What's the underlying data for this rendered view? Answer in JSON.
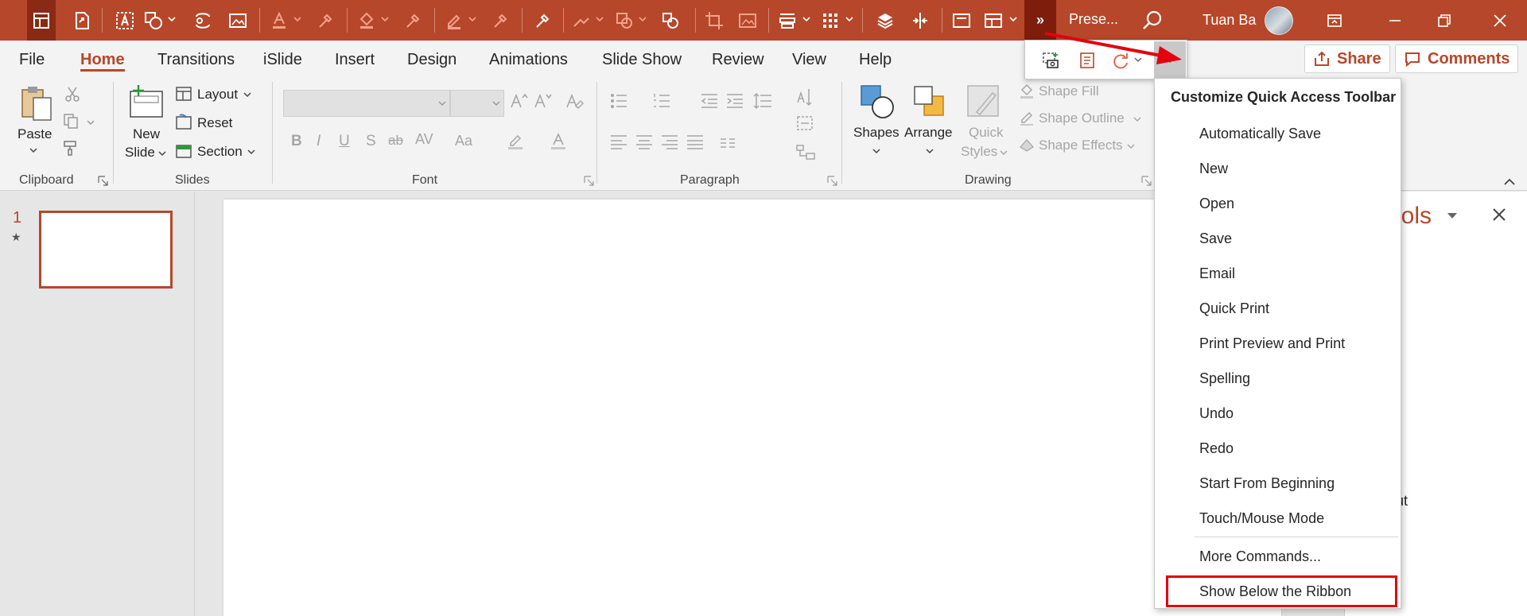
{
  "titlebar": {
    "doc_title": "Prese...",
    "user_name": "Tuan Ba",
    "overflow_label": "»"
  },
  "tabs": [
    "File",
    "Home",
    "Transitions",
    "iSlide",
    "Insert",
    "Design",
    "Animations",
    "Slide Show",
    "Review",
    "View",
    "Help"
  ],
  "top_actions": {
    "share": "Share",
    "comments": "Comments"
  },
  "ribbon": {
    "clipboard": {
      "paste": "Paste",
      "group": "Clipboard"
    },
    "slides": {
      "new_slide_1": "New",
      "new_slide_2": "Slide",
      "layout": "Layout",
      "reset": "Reset",
      "section": "Section",
      "group": "Slides"
    },
    "font": {
      "group": "Font"
    },
    "paragraph": {
      "group": "Paragraph"
    },
    "drawing": {
      "shapes": "Shapes",
      "arrange": "Arrange",
      "quick_styles_1": "Quick",
      "quick_styles_2": "Styles",
      "shape_fill": "Shape Fill",
      "shape_outline": "Shape Outline",
      "shape_effects": "Shape Effects",
      "group": "Drawing"
    }
  },
  "thumbnails": {
    "slide_number": "1",
    "star": "★"
  },
  "task_pane": {
    "title_fragment": "ools",
    "text_fragment": "ut"
  },
  "customize_menu": {
    "header": "Customize Quick Access Toolbar",
    "items": [
      "Automatically Save",
      "New",
      "Open",
      "Save",
      "Email",
      "Quick Print",
      "Print Preview and Print",
      "Spelling",
      "Undo",
      "Redo",
      "Start From Beginning",
      "Touch/Mouse Mode"
    ],
    "more_commands": "More Commands...",
    "show_below": "Show Below the Ribbon"
  },
  "colors": {
    "accent": "#b7472a",
    "highlight": "#e3000f"
  }
}
